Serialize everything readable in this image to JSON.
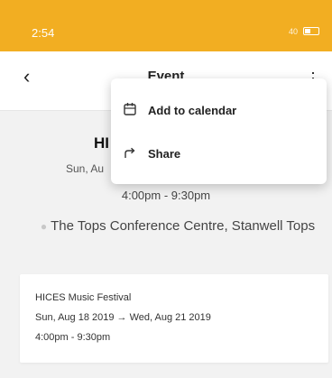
{
  "status_bar": {
    "time": "2:54",
    "network": "40"
  },
  "header": {
    "title": "Event"
  },
  "event": {
    "title_visible": "HI",
    "date_visible": "Sun, Au",
    "time": "4:00pm - 9:30pm",
    "location": "The Tops Conference Centre, Stanwell Tops"
  },
  "card": {
    "title": "HICES Music Festival",
    "dates": "Sun, Aug 18 2019 → Wed, Aug 21 2019",
    "time": "4:00pm - 9:30pm"
  },
  "menu": {
    "items": [
      {
        "label": "Add to calendar",
        "icon": "calendar-icon"
      },
      {
        "label": "Share",
        "icon": "share-icon"
      }
    ]
  },
  "colors": {
    "status_bar": "#f2ae22",
    "background": "#f2f2f2"
  }
}
